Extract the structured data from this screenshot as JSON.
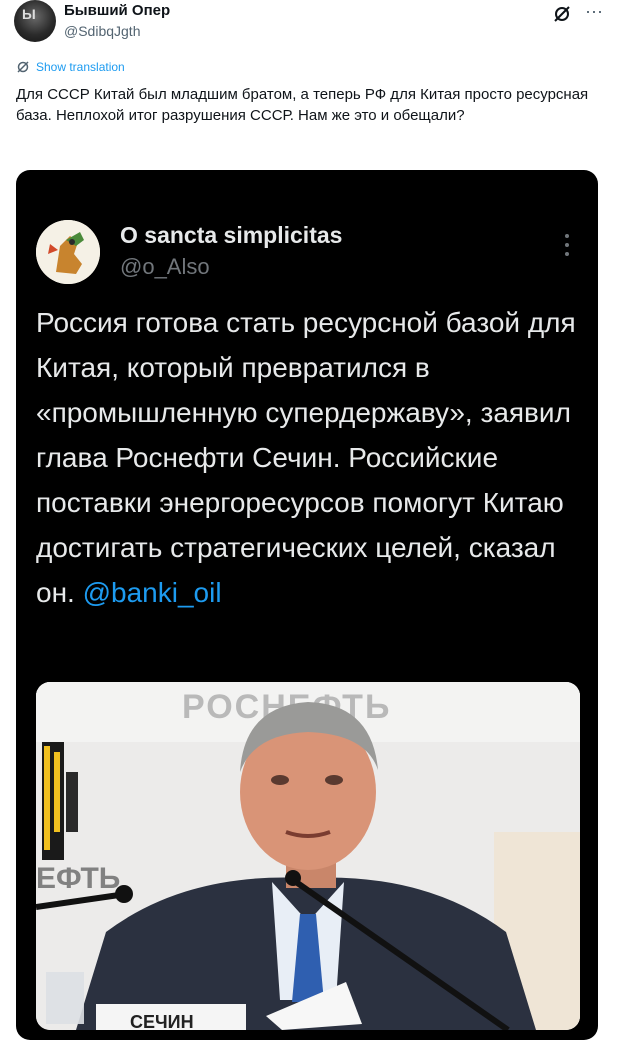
{
  "post": {
    "author_name": "Бывший Опер",
    "author_handle": "@SdibqJgth",
    "show_translation": "Show translation",
    "text": "Для СССР Китай был младшим братом, а теперь РФ для Китая просто ресурсная база. Неплохой итог разрушения СССР. Нам же это и обещали?"
  },
  "quoted": {
    "name": "O sancta simplicitas",
    "handle": "@o_Also",
    "text": "Россия готова стать ресурсной базой для Китая, который превратился в «промышленную супердержаву», заявил глава Роснефти Сечин. Российские поставки энергоресурсов помогут Китаю достигать стратегических целей, сказал он.",
    "mention": "@banki_oil"
  },
  "photo": {
    "backdrop_logo": "РОСНЕФТЬ",
    "side_logo": "ЕФТЬ",
    "nameplate": "СЕЧИН"
  },
  "icons": {
    "grok": "grok-icon",
    "more": "more-icon",
    "translate": "translate-icon",
    "quoted_more": "vertical-more-icon"
  },
  "colors": {
    "link": "#1d9bf0",
    "media_bg": "#000000",
    "text_dark": "#0f1419",
    "text_muted": "#536471"
  }
}
